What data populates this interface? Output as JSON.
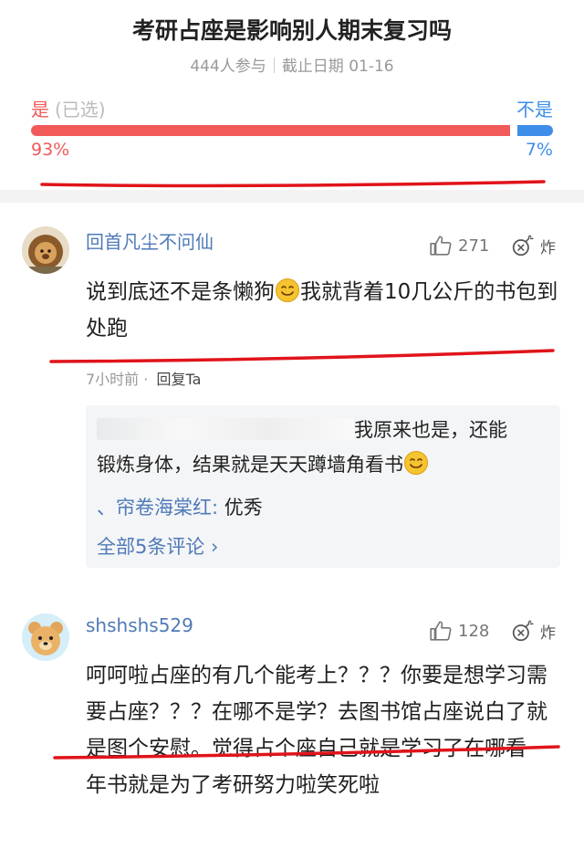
{
  "poll": {
    "title": "考研占座是影响别人期末复习吗",
    "participants": "444人参与",
    "deadline": "截止日期 01-16",
    "option_yes": "是",
    "selected_tag": "(已选)",
    "option_no": "不是",
    "yes_pct": "93%",
    "no_pct": "7%",
    "yes_fraction": 0.93,
    "yes_color": "#f25a5a",
    "no_color": "#3d8ee8"
  },
  "comments": [
    {
      "username": "回首凡尘不问仙",
      "likes": "271",
      "bomb_label": "炸",
      "text_part1": "说到底还不是条懒狗",
      "text_part2": "我就背着10几公斤的书包到处跑",
      "time": "7小时前",
      "dot": "·",
      "reply_label": "回复Ta",
      "reply": {
        "text_line1": "我原来也是，还能",
        "text_line2": "锻炼身体，结果就是天天蹲墙角看书",
        "sub_name": "、帘卷海棠红:",
        "sub_text": "优秀",
        "all_link": "全部5条评论 ›"
      }
    },
    {
      "username": "shshshs529",
      "likes": "128",
      "bomb_label": "炸",
      "text": "呵呵啦占座的有几个能考上？？？你要是想学习需要占座？？？在哪不是学？去图书馆占座说白了就是图个安慰。觉得占个座自己就是学习了在哪看一年书就是为了考研努力啦笑死啦"
    }
  ],
  "icons": {
    "like": "thumbs-up-icon",
    "bomb": "bomb-icon",
    "emoji": "smiley-emoji-icon"
  }
}
